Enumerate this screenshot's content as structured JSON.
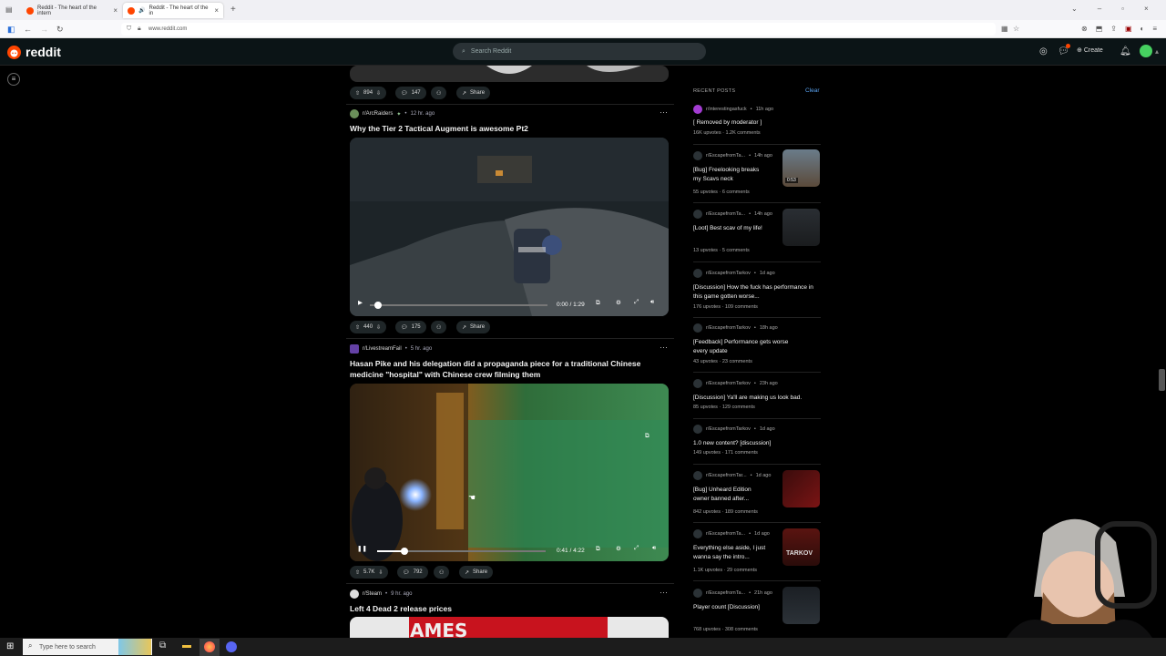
{
  "browser": {
    "tabs": [
      {
        "label": "Reddit - The heart of the intern"
      },
      {
        "label": "Reddit - The heart of the in"
      }
    ],
    "url": "www.reddit.com"
  },
  "header": {
    "logo": "reddit",
    "search_placeholder": "Search Reddit",
    "create_label": "Create"
  },
  "feed": {
    "top_post": {
      "upvotes": "894",
      "comments": "147",
      "share": "Share"
    },
    "posts": [
      {
        "subreddit": "r/ArcRaiders",
        "time": "12 hr. ago",
        "title": "Why the Tier 2 Tactical Augment is awesome Pt2",
        "video_time": "0:00 / 1:29",
        "upvotes": "440",
        "comments": "175",
        "share": "Share"
      },
      {
        "subreddit": "r/LivestreamFail",
        "time": "5 hr. ago",
        "title": "Hasan Pike and his delegation did a propaganda piece for a traditional Chinese medicine \"hospital\" with Chinese crew filming them",
        "video_time": "0:41 / 4:22",
        "upvotes": "5.7K",
        "comments": "792",
        "share": "Share"
      },
      {
        "subreddit": "r/Steam",
        "time": "9 hr. ago",
        "title": "Left 4 Dead 2 release prices",
        "image_text": "AMES"
      }
    ]
  },
  "sidebar": {
    "heading": "RECENT POSTS",
    "clear": "Clear",
    "items": [
      {
        "sub": "r/interestingasfuck",
        "time": "11h ago",
        "title": "[ Removed by moderator ]",
        "upvotes": "16K upvotes",
        "comments": "1.2K comments"
      },
      {
        "sub": "r/EscapefromTa...",
        "time": "14h ago",
        "title": "[Bug] Freelooking breaks my Scavs neck",
        "upvotes": "55 upvotes",
        "comments": "6 comments",
        "thumb_label": "0:53"
      },
      {
        "sub": "r/EscapefromTa...",
        "time": "14h ago",
        "title": "[Loot] Best scav of my life!",
        "upvotes": "13 upvotes",
        "comments": "5 comments"
      },
      {
        "sub": "r/EscapefromTarkov",
        "time": "1d ago",
        "title": "[Discussion] How the fuck has performance in this game gotten worse...",
        "upvotes": "176 upvotes",
        "comments": "109 comments"
      },
      {
        "sub": "r/EscapefromTarkov",
        "time": "18h ago",
        "title": "[Feedback] Performance gets worse every update",
        "upvotes": "43 upvotes",
        "comments": "23 comments"
      },
      {
        "sub": "r/EscapefromTarkov",
        "time": "23h ago",
        "title": "[Discussion] Ya'll are making us look bad.",
        "upvotes": "85 upvotes",
        "comments": "129 comments"
      },
      {
        "sub": "r/EscapefromTarkov",
        "time": "1d ago",
        "title": "1.0 new content? [discussion]",
        "upvotes": "149 upvotes",
        "comments": "171 comments"
      },
      {
        "sub": "r/EscapefromTar...",
        "time": "1d ago",
        "title": "[Bug] Unheard Edition owner banned after...",
        "upvotes": "842 upvotes",
        "comments": "189 comments"
      },
      {
        "sub": "r/EscapefromTa...",
        "time": "1d ago",
        "title": "Everything else aside, I just wanna say the intro...",
        "upvotes": "1.1K upvotes",
        "comments": "29 comments",
        "thumb_label": "TARKOV"
      },
      {
        "sub": "r/EscapefromTa...",
        "time": "21h ago",
        "title": "Player count [Discussion]",
        "upvotes": "768 upvotes",
        "comments": "308 comments"
      }
    ]
  },
  "taskbar": {
    "search_placeholder": "Type here to search"
  }
}
